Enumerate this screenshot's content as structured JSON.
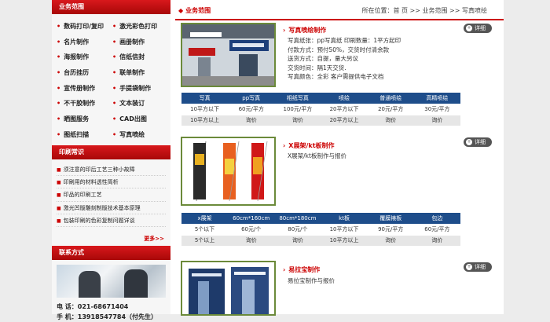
{
  "sidebar": {
    "business_title": "业务范围",
    "business_items": [
      "数码打印/复印",
      "激光彩色打印",
      "名片制作",
      "画册制作",
      "海报制作",
      "信纸信封",
      "台历挂历",
      "联单制作",
      "宣传册制作",
      "手提袋制作",
      "不干胶制作",
      "文本装订",
      "晒图服务",
      "CAD出图",
      "图纸扫描",
      "写真喷绘"
    ],
    "knowledge_title": "印刷常识",
    "knowledge_items": [
      "须注意的印后工艺三种小故障",
      "印刷用的材料透性简析",
      "印品的印刷工艺",
      "激光凹版雕刻制版技术基本原理",
      "包装印刷的色彩复制问题详谈"
    ],
    "more": "更多>>",
    "contact_title": "联系方式",
    "phone_label": "电 话：",
    "phone": "021-68671404",
    "mobile_label": "手 机：",
    "mobile": "13918547784（付先生）"
  },
  "main": {
    "title": "业务范围",
    "breadcrumb": "所在位置：首 页 >> 业务范围 >> 写真喷绘",
    "detail_label": "详细",
    "products": [
      {
        "title": "写真喷绘制作",
        "desc": [
          "写真纸张：pp写真纸 印刷数量：1平方起印",
          "付款方式：预付50%，交货时付清余款",
          "送货方式：自提，量大另议",
          "交货时间：隔1天交货.",
          "写真颜色：全彩 客户需提供电子文档"
        ],
        "headers": [
          "写真",
          "pp写真",
          "相纸写真",
          "喷绘",
          "普通喷绘",
          "高精喷绘"
        ],
        "rows": [
          [
            "10平方以下",
            "60元/平方",
            "100元/平方",
            "20平方以下",
            "20元/平方",
            "30元/平方"
          ],
          [
            "10平方以上",
            "询价",
            "询价",
            "20平方以上",
            "询价",
            "询价"
          ]
        ]
      },
      {
        "title": "X展架/kt板制作",
        "desc": [
          "X展架/kt板制作与报价"
        ],
        "headers": [
          "x展架",
          "60cm*160cm",
          "80cm*180cm",
          "kt板",
          "覆膜裱板",
          "包边"
        ],
        "rows": [
          [
            "5个以下",
            "60元/个",
            "80元/个",
            "10平方以下",
            "90元/平方",
            "60元/平方"
          ],
          [
            "5个以上",
            "询价",
            "询价",
            "10平方以上",
            "询价",
            "询价"
          ]
        ]
      },
      {
        "title": "易拉宝制作",
        "desc": [
          "易拉宝制作与报价"
        ]
      }
    ]
  },
  "colors": {
    "accent": "#c00000",
    "table_header": "#1e4d8a",
    "thumb_border": "#6b8a3a"
  }
}
